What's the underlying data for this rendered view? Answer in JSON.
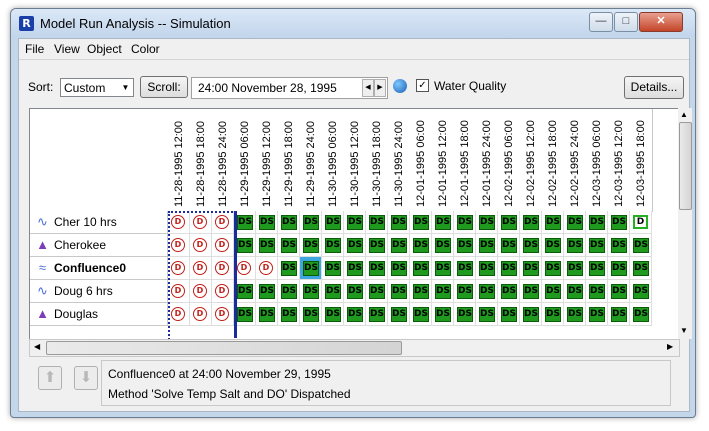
{
  "window": {
    "title": "Model Run Analysis -- Simulation",
    "app_icon": "R"
  },
  "menu": [
    "File",
    "View",
    "Object",
    "Color"
  ],
  "toolbar": {
    "sort_label": "Sort:",
    "sort_value": "Custom",
    "scroll_label": "Scroll:",
    "datetime": "24:00 November 28, 1995",
    "water_quality_label": "Water Quality",
    "water_quality_checked": true,
    "details_label": "Details..."
  },
  "columns": [
    "11-28-1995 12:00",
    "11-28-1995 18:00",
    "11-28-1995 24:00",
    "11-29-1995 06:00",
    "11-29-1995 12:00",
    "11-29-1995 18:00",
    "11-29-1995 24:00",
    "11-30-1995 06:00",
    "11-30-1995 12:00",
    "11-30-1995 18:00",
    "11-30-1995 24:00",
    "12-01-1995 06:00",
    "12-01-1995 12:00",
    "12-01-1995 18:00",
    "12-01-1995 24:00",
    "12-02-1995 06:00",
    "12-02-1995 12:00",
    "12-02-1995 18:00",
    "12-02-1995 24:00",
    "12-03-1995 06:00",
    "12-03-1995 12:00",
    "12-03-1995 18:00"
  ],
  "rows": [
    {
      "name": "Cher 10 hrs",
      "icon": "reach-icon",
      "bold": false,
      "cells": [
        "nd",
        "nd",
        "nd",
        "ds",
        "ds",
        "ds",
        "ds",
        "ds",
        "ds",
        "ds",
        "ds",
        "ds",
        "ds",
        "ds",
        "ds",
        "ds",
        "ds",
        "ds",
        "ds",
        "ds",
        "ds",
        "ds-hollow"
      ]
    },
    {
      "name": "Cherokee",
      "icon": "reservoir-icon",
      "bold": false,
      "cells": [
        "nd",
        "nd",
        "nd",
        "ds",
        "ds",
        "ds",
        "ds",
        "ds",
        "ds",
        "ds",
        "ds",
        "ds",
        "ds",
        "ds",
        "ds",
        "ds",
        "ds",
        "ds",
        "ds",
        "ds",
        "ds",
        "ds"
      ]
    },
    {
      "name": "Confluence0",
      "icon": "confluence-icon",
      "bold": true,
      "cells": [
        "nd",
        "nd",
        "nd",
        "nd",
        "nd",
        "ds",
        "ds-sel",
        "ds",
        "ds",
        "ds",
        "ds",
        "ds",
        "ds",
        "ds",
        "ds",
        "ds",
        "ds",
        "ds",
        "ds",
        "ds",
        "ds",
        "ds"
      ]
    },
    {
      "name": "Doug 6 hrs",
      "icon": "reach-icon",
      "bold": false,
      "cells": [
        "nd",
        "nd",
        "nd",
        "ds",
        "ds",
        "ds",
        "ds",
        "ds",
        "ds",
        "ds",
        "ds",
        "ds",
        "ds",
        "ds",
        "ds",
        "ds",
        "ds",
        "ds",
        "ds",
        "ds",
        "ds",
        "ds"
      ]
    },
    {
      "name": "Douglas",
      "icon": "reservoir-icon",
      "bold": false,
      "cells": [
        "nd",
        "nd",
        "nd",
        "ds",
        "ds",
        "ds",
        "ds",
        "ds",
        "ds",
        "ds",
        "ds",
        "ds",
        "ds",
        "ds",
        "ds",
        "ds",
        "ds",
        "ds",
        "ds",
        "ds",
        "ds",
        "ds"
      ]
    }
  ],
  "glyphs": {
    "ds": "DS",
    "nd": "D"
  },
  "status": {
    "line1": "Confluence0 at 24:00 November 29, 1995",
    "line2": "Method 'Solve Temp Salt and DO' Dispatched"
  },
  "icons": {
    "up": "up-arrow-icon",
    "down": "down-arrow-icon"
  }
}
